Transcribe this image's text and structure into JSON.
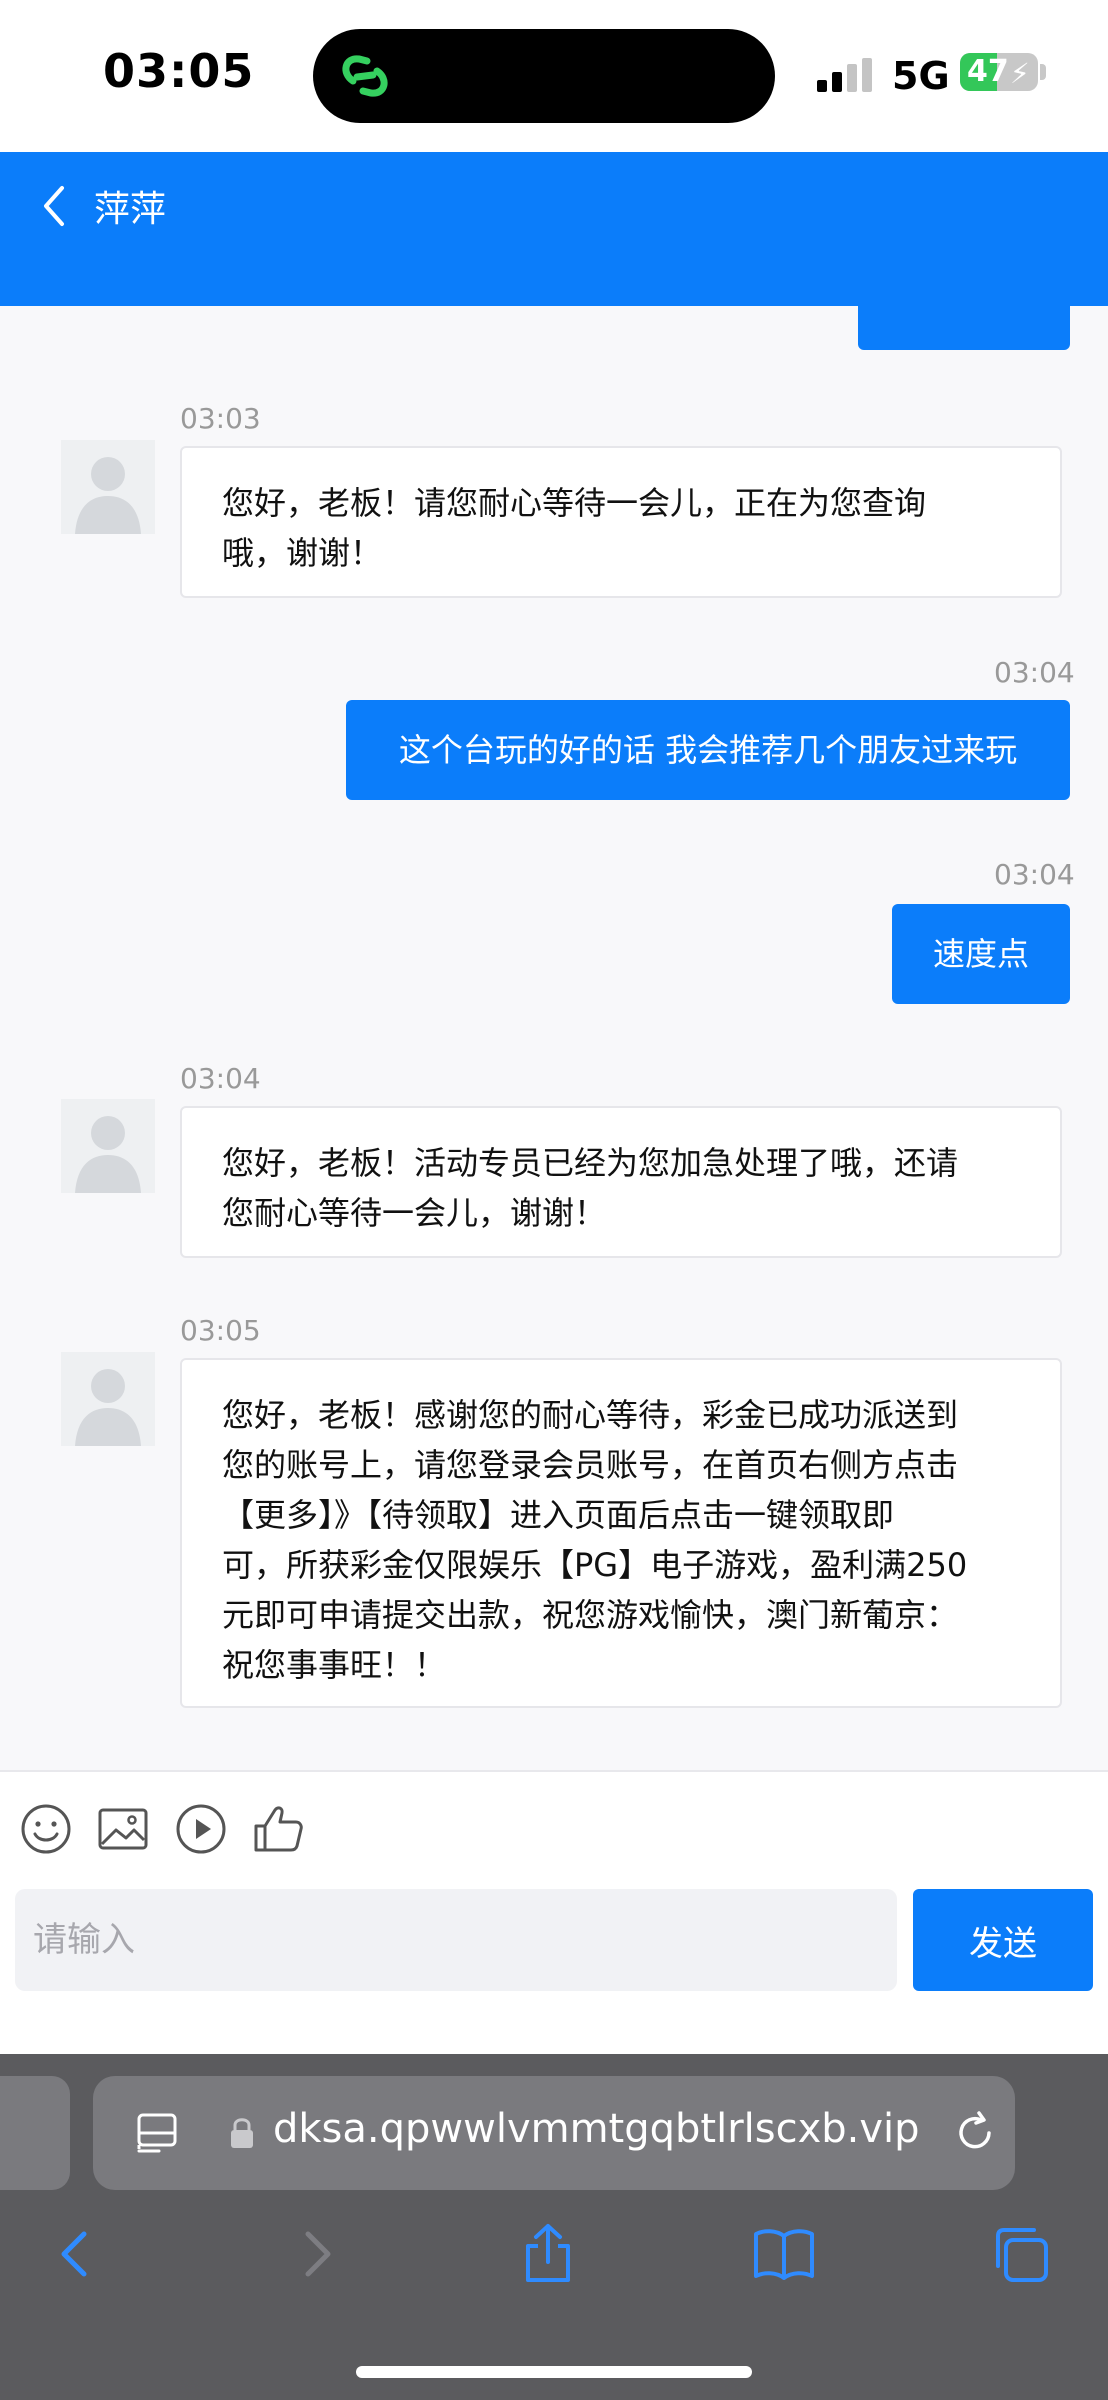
{
  "status_bar": {
    "time": "03:05",
    "network": "5G",
    "battery_level": "47",
    "battery_fraction": 0.47
  },
  "header": {
    "title": "萍萍",
    "accent_color": "#0b7dfa"
  },
  "messages": [
    {
      "side": "in",
      "time": "03:03",
      "text": "您好，老板！请您耐心等待一会儿，正在为您查询\n哦，谢谢！"
    },
    {
      "side": "out",
      "time": "03:04",
      "text": "这个台玩的好的话 我会推荐几个朋友过来玩"
    },
    {
      "side": "out",
      "time": "03:04",
      "text": "速度点"
    },
    {
      "side": "in",
      "time": "03:04",
      "text": "您好，老板！活动专员已经为您加急处理了哦，还请\n您耐心等待一会儿，谢谢！"
    },
    {
      "side": "in",
      "time": "03:05",
      "text": "您好，老板！感谢您的耐心等待，彩金已成功派送到\n您的账号上，请您登录会员账号，在首页右侧方点击\n【更多】》【待领取】进入页面后点击一键领取即\n可，所获彩金仅限娱乐【PG】电子游戏，盈利满250\n元即可申请提交出款，祝您游戏愉快，澳门新葡京：\n祝您事事旺！！"
    }
  ],
  "composer": {
    "tools": [
      "emoji-icon",
      "image-icon",
      "video-icon",
      "thumbs-up-icon"
    ],
    "input_placeholder": "请输入",
    "input_value": "",
    "send_label": "发送"
  },
  "browser": {
    "url": "dksa.qpwwlvmmtgqbtlrlscxb.vip",
    "nav_icons": [
      "back-icon",
      "forward-icon",
      "share-icon",
      "bookmarks-icon",
      "tabs-icon"
    ]
  }
}
